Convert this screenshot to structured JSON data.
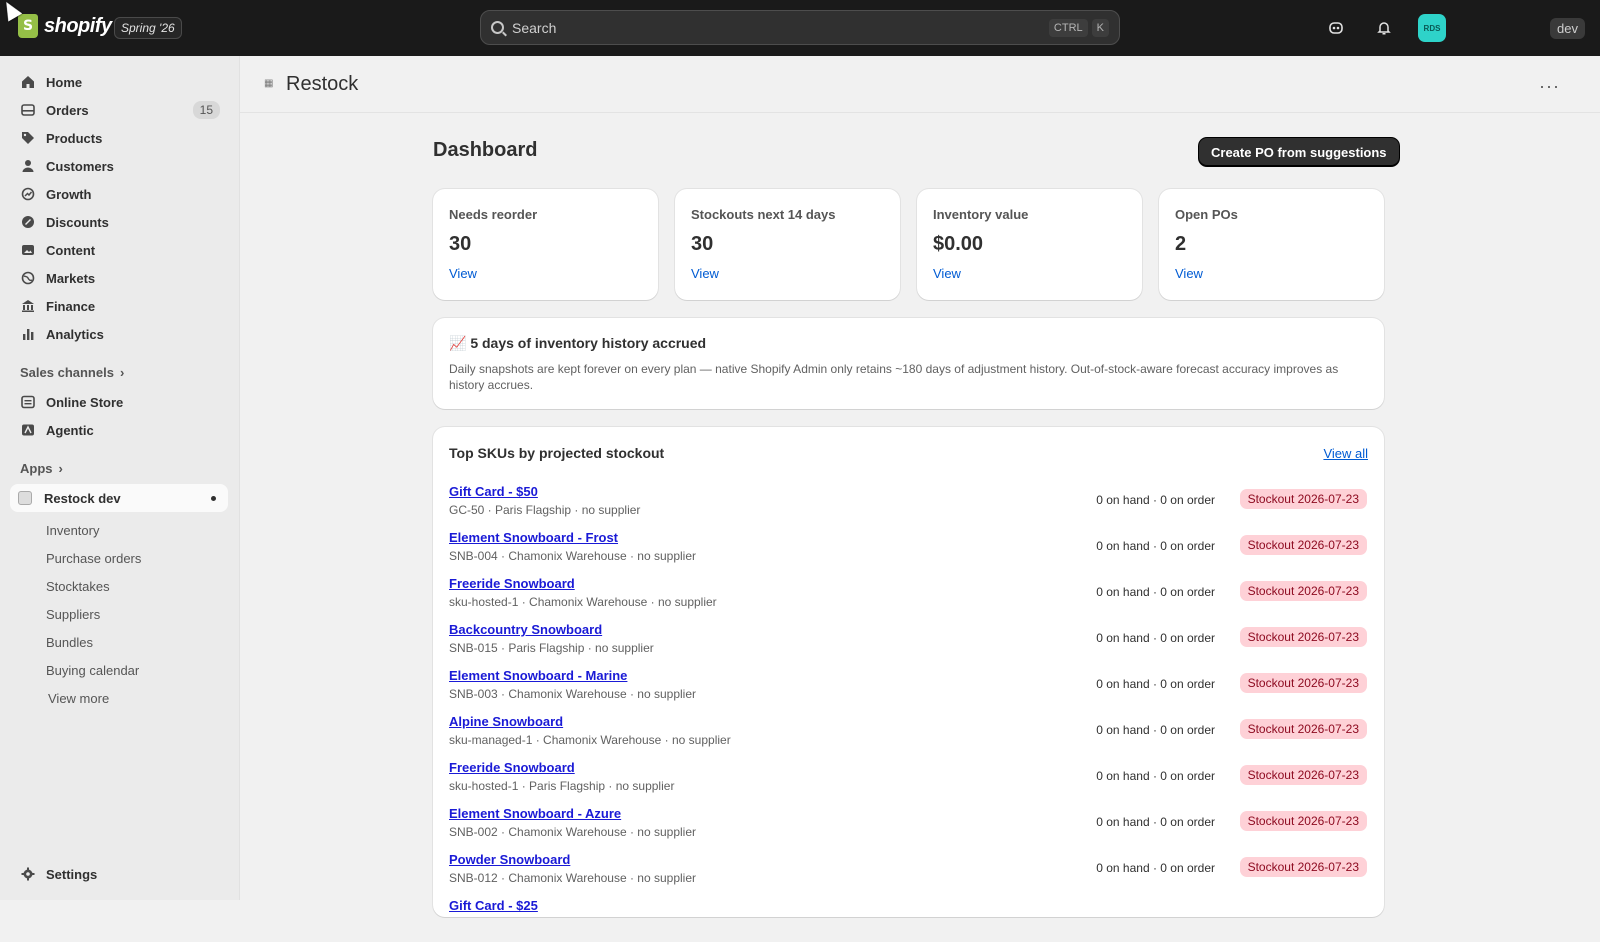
{
  "topbar": {
    "logo_text": "shopify",
    "release": "Spring '26",
    "search_placeholder": "Search",
    "shortcut_key1": "CTRL",
    "shortcut_key2": "K",
    "avatar_initials": "RDS",
    "store_badge": "dev"
  },
  "sidebar": {
    "items": [
      {
        "label": "Home",
        "icon": "home-icon"
      },
      {
        "label": "Orders",
        "icon": "orders-icon",
        "count": "15"
      },
      {
        "label": "Products",
        "icon": "tag-icon"
      },
      {
        "label": "Customers",
        "icon": "person-icon"
      },
      {
        "label": "Growth",
        "icon": "growth-icon"
      },
      {
        "label": "Discounts",
        "icon": "discount-icon"
      },
      {
        "label": "Content",
        "icon": "content-icon"
      },
      {
        "label": "Markets",
        "icon": "globe-icon"
      },
      {
        "label": "Finance",
        "icon": "bank-icon"
      },
      {
        "label": "Analytics",
        "icon": "bar-chart-icon"
      }
    ],
    "sales_channels_label": "Sales channels",
    "channels": [
      {
        "label": "Online Store"
      },
      {
        "label": "Agentic"
      }
    ],
    "apps_label": "Apps",
    "active_app": "Restock dev",
    "app_subitems": [
      "Inventory",
      "Purchase orders",
      "Stocktakes",
      "Suppliers",
      "Bundles",
      "Buying calendar"
    ],
    "view_more": "View more",
    "settings": "Settings"
  },
  "page": {
    "title": "Restock",
    "dashboard_title": "Dashboard",
    "primary_action": "Create PO from suggestions"
  },
  "stats": [
    {
      "label": "Needs reorder",
      "value": "30",
      "link": "View"
    },
    {
      "label": "Stockouts next 14 days",
      "value": "30",
      "link": "View"
    },
    {
      "label": "Inventory value",
      "value": "$0.00",
      "link": "View"
    },
    {
      "label": "Open POs",
      "value": "2",
      "link": "View"
    }
  ],
  "history": {
    "emoji": "📈",
    "title": "5 days of inventory history accrued",
    "body": "Daily snapshots are kept forever on every plan — native Shopify Admin only retains ~180 days of adjustment history. Out-of-stock-aware forecast accuracy improves as history accrues."
  },
  "skus": {
    "title": "Top SKUs by projected stockout",
    "view_all": "View all",
    "rows": [
      {
        "name": "Gift Card - $50",
        "meta": "GC-50 · Paris Flagship · no supplier",
        "stock": "0 on hand · 0 on order",
        "badge": "Stockout 2026-07-23"
      },
      {
        "name": "Element Snowboard - Frost",
        "meta": "SNB-004 · Chamonix Warehouse · no supplier",
        "stock": "0 on hand · 0 on order",
        "badge": "Stockout 2026-07-23"
      },
      {
        "name": "Freeride Snowboard",
        "meta": "sku-hosted-1 · Chamonix Warehouse · no supplier",
        "stock": "0 on hand · 0 on order",
        "badge": "Stockout 2026-07-23"
      },
      {
        "name": "Backcountry Snowboard",
        "meta": "SNB-015 · Paris Flagship · no supplier",
        "stock": "0 on hand · 0 on order",
        "badge": "Stockout 2026-07-23"
      },
      {
        "name": "Element Snowboard - Marine",
        "meta": "SNB-003 · Chamonix Warehouse · no supplier",
        "stock": "0 on hand · 0 on order",
        "badge": "Stockout 2026-07-23"
      },
      {
        "name": "Alpine Snowboard",
        "meta": "sku-managed-1 · Chamonix Warehouse · no supplier",
        "stock": "0 on hand · 0 on order",
        "badge": "Stockout 2026-07-23"
      },
      {
        "name": "Freeride Snowboard",
        "meta": "sku-hosted-1 · Paris Flagship · no supplier",
        "stock": "0 on hand · 0 on order",
        "badge": "Stockout 2026-07-23"
      },
      {
        "name": "Element Snowboard - Azure",
        "meta": "SNB-002 · Chamonix Warehouse · no supplier",
        "stock": "0 on hand · 0 on order",
        "badge": "Stockout 2026-07-23"
      },
      {
        "name": "Powder Snowboard",
        "meta": "SNB-012 · Chamonix Warehouse · no supplier",
        "stock": "0 on hand · 0 on order",
        "badge": "Stockout 2026-07-23"
      },
      {
        "name": "Gift Card - $25",
        "meta": "",
        "stock": "",
        "badge": ""
      }
    ]
  },
  "colors": {
    "link": "#005bd3",
    "badge_bg": "#fed1d7",
    "avatar": "#2ed3c9"
  }
}
